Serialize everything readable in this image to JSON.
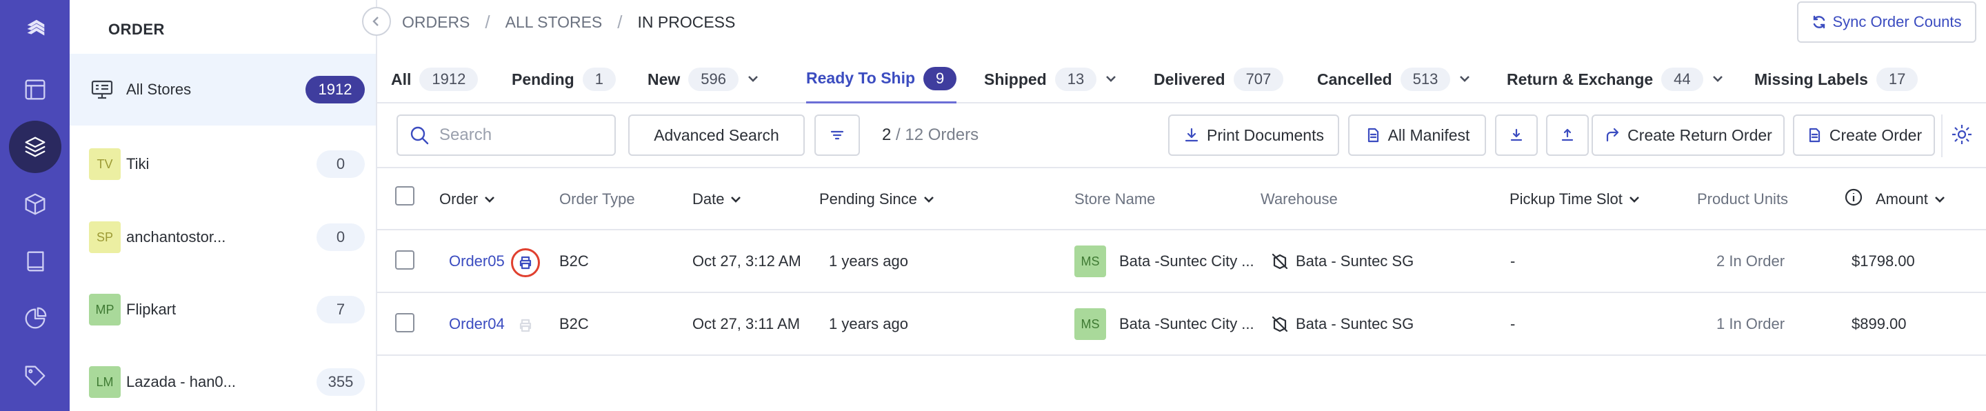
{
  "nav": {
    "icons": [
      "logo-icon",
      "layout-icon",
      "layers-icon",
      "box-icon",
      "book-icon",
      "pie-chart-icon",
      "tag-icon"
    ]
  },
  "stores": {
    "heading": "ORDER",
    "all": {
      "name": "All Stores",
      "count": "1912"
    },
    "items": [
      {
        "initials": "TV",
        "name": "Tiki",
        "count": "0",
        "bg": "#ecefa2",
        "fg": "#9c9a34"
      },
      {
        "initials": "SP",
        "name": "anchantostor...",
        "count": "0",
        "bg": "#ecefa2",
        "fg": "#9c9a34"
      },
      {
        "initials": "MP",
        "name": "Flipkart",
        "count": "7",
        "bg": "#a9d99a",
        "fg": "#3f7a33"
      },
      {
        "initials": "LM",
        "name": "Lazada - han0...",
        "count": "355",
        "bg": "#a9d99a",
        "fg": "#3f7a33"
      }
    ]
  },
  "breadcrumb": {
    "root": "ORDERS",
    "mid": "ALL STORES",
    "current": "IN PROCESS"
  },
  "sync_label": "Sync Order Counts",
  "tabs": [
    {
      "label": "All",
      "count": "1912"
    },
    {
      "label": "Pending",
      "count": "1"
    },
    {
      "label": "New",
      "count": "596"
    },
    {
      "label": "Ready To Ship",
      "count": "9"
    },
    {
      "label": "Shipped",
      "count": "13"
    },
    {
      "label": "Delivered",
      "count": "707"
    },
    {
      "label": "Cancelled",
      "count": "513"
    },
    {
      "label": "Return & Exchange",
      "count": "44"
    },
    {
      "label": "Missing Labels",
      "count": "17"
    }
  ],
  "toolbar": {
    "search_placeholder": "Search",
    "advanced_search": "Advanced Search",
    "selected": "2",
    "total": " / 12 Orders",
    "print_documents": "Print Documents",
    "all_manifest": "All Manifest",
    "create_return_order": "Create Return Order",
    "create_order": "Create Order"
  },
  "columns": {
    "order": "Order",
    "order_type": "Order Type",
    "date": "Date",
    "pending_since": "Pending Since",
    "store_name": "Store Name",
    "warehouse": "Warehouse",
    "pickup_time_slot": "Pickup Time Slot",
    "product_units": "Product Units",
    "amount": "Amount"
  },
  "rows": [
    {
      "order": "Order05",
      "type": "B2C",
      "date": "Oct 27, 3:12 AM",
      "pending": "1 years ago",
      "store_initials": "MS",
      "store": "Bata -Suntec City ...",
      "warehouse": "Bata - Suntec SG",
      "pickup": "-",
      "units": "2 In Order",
      "amount": "$1798.00"
    },
    {
      "order": "Order04",
      "type": "B2C",
      "date": "Oct 27, 3:11 AM",
      "pending": "1 years ago",
      "store_initials": "MS",
      "store": "Bata -Suntec City ...",
      "warehouse": "Bata - Suntec SG",
      "pickup": "-",
      "units": "1 In Order",
      "amount": "$899.00"
    }
  ],
  "colors": {
    "rail": "#4b49b8",
    "accent": "#3b4cc0",
    "badge_dark": "#3f3d9e",
    "highlight": "#e0402f"
  }
}
